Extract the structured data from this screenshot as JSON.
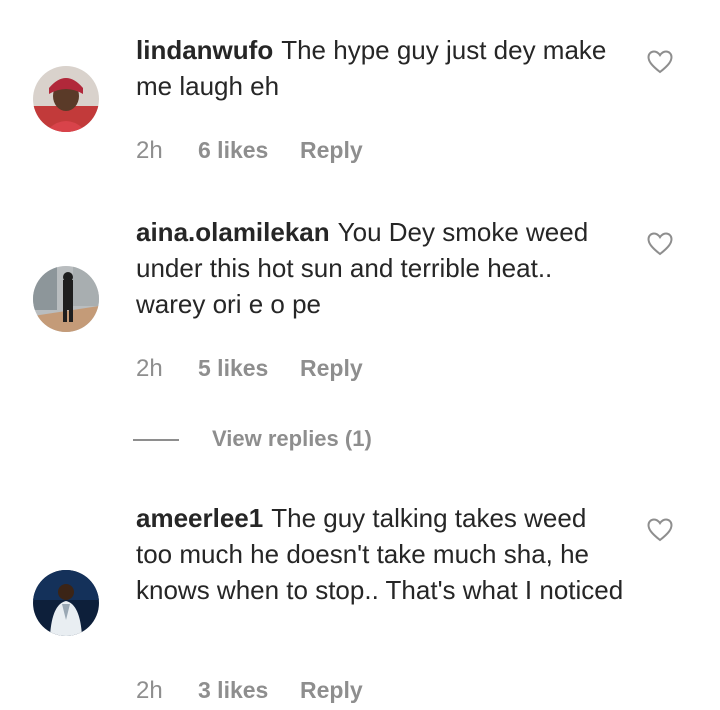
{
  "comments": [
    {
      "username": "lindanwufo",
      "text": "The hype guy just dey make me laugh eh",
      "time": "2h",
      "likes": "6 likes",
      "reply": "Reply"
    },
    {
      "username": "aina.olamilekan",
      "text": "You Dey smoke weed under this hot sun and terrible heat.. warey ori e o pe",
      "time": "2h",
      "likes": "5 likes",
      "reply": "Reply"
    },
    {
      "username": "ameerlee1",
      "text": "The guy talking takes weed too much he doesn't take much sha, he knows when to stop.. That's what I noticed",
      "time": "2h",
      "likes": "3 likes",
      "reply": "Reply"
    }
  ],
  "view_replies": "View replies (1)",
  "icons": {
    "like": "heart-outline-icon"
  }
}
